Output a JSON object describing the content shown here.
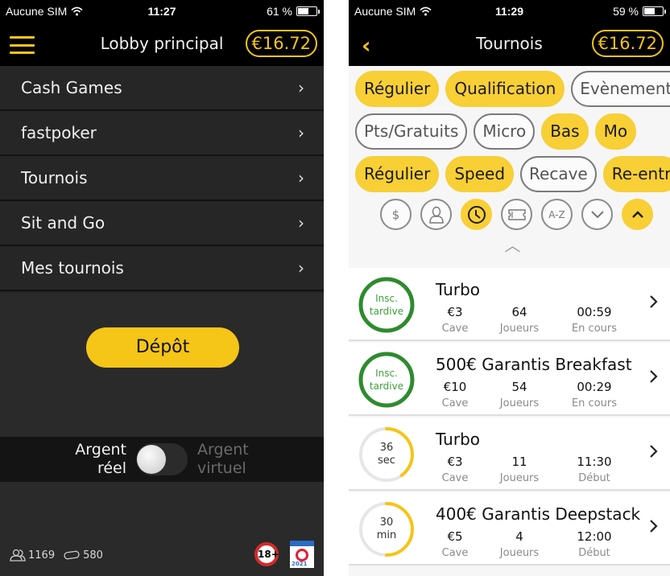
{
  "colors": {
    "accent": "#f5c518",
    "chip_active": "#f9cf36",
    "green_ring": "#2e8b2e",
    "yellow_ring": "#f6c415"
  },
  "left_screen": {
    "status": {
      "carrier": "Aucune SIM",
      "time": "11:27",
      "battery": "61 %",
      "battery_level": 0.61
    },
    "nav": {
      "menu_icon": "hamburger-icon",
      "title": "Lobby principal",
      "balance": "€16.72"
    },
    "menu": [
      {
        "label": "Cash Games",
        "icon": "chevron-right-icon",
        "chev": "›"
      },
      {
        "label": "fastpoker",
        "icon": "chevron-right-icon",
        "chev": "›"
      },
      {
        "label": "Tournois",
        "icon": "chevron-right-icon",
        "chev": "›"
      },
      {
        "label": "Sit and Go",
        "icon": "chevron-right-icon",
        "chev": "›"
      },
      {
        "label": "Mes tournois",
        "icon": "chevron-right-icon",
        "chev": "›"
      }
    ],
    "deposit_label": "Dépôt",
    "money_toggle": {
      "real_line1": "Argent",
      "real_line2": "réel",
      "virtual_line1": "Argent",
      "virtual_line2": "virtuel",
      "selected": "real"
    },
    "footer": {
      "players": "1169",
      "tables": "580",
      "age_badge": "18+",
      "arjel_year": "2021"
    }
  },
  "right_screen": {
    "status": {
      "carrier": "Aucune SIM",
      "time": "11:29",
      "battery": "59 %",
      "battery_level": 0.59
    },
    "nav": {
      "back_icon": "back-chevron-icon",
      "back_glyph": "‹",
      "title": "Tournois",
      "balance": "€16.72"
    },
    "filter_rows": [
      [
        {
          "label": "Régulier",
          "active": true
        },
        {
          "label": "Qualification",
          "active": true
        },
        {
          "label": "Evènements",
          "active": false
        }
      ],
      [
        {
          "label": "Pts/Gratuits",
          "active": false
        },
        {
          "label": "Micro",
          "active": false
        },
        {
          "label": "Bas",
          "active": true
        },
        {
          "label": "Mo",
          "active": true
        }
      ],
      [
        {
          "label": "Régulier",
          "active": true
        },
        {
          "label": "Speed",
          "active": true
        },
        {
          "label": "Recave",
          "active": false
        },
        {
          "label": "Re-entr",
          "active": true
        }
      ]
    ],
    "sort_icons": [
      {
        "name": "dollar-icon",
        "glyph": "$",
        "active": false
      },
      {
        "name": "player-icon",
        "glyph": "",
        "active": false
      },
      {
        "name": "clock-icon",
        "glyph": "",
        "active": true
      },
      {
        "name": "ticket-icon",
        "glyph": "",
        "active": false
      },
      {
        "name": "az-sort-icon",
        "glyph": "A-Z",
        "active": false
      },
      {
        "name": "sort-descending-icon",
        "glyph": "⌄",
        "active": false
      },
      {
        "name": "sort-ascending-icon",
        "glyph": "⌃",
        "active": true
      }
    ],
    "collapse_glyph": "︿",
    "tournaments": [
      {
        "name": "Turbo",
        "status_line1": "Insc.",
        "status_line2": "tardive",
        "status_type": "late",
        "progress": 1.0,
        "buyin": "€3",
        "buyin_label": "Cave",
        "players": "64",
        "players_label": "Joueurs",
        "time": "00:59",
        "time_label": "En cours"
      },
      {
        "name": "500€ Garantis Breakfast",
        "status_line1": "Insc.",
        "status_line2": "tardive",
        "status_type": "late",
        "progress": 1.0,
        "buyin": "€10",
        "buyin_label": "Cave",
        "players": "54",
        "players_label": "Joueurs",
        "time": "00:29",
        "time_label": "En cours"
      },
      {
        "name": "Turbo",
        "status_line1": "36",
        "status_line2": "sec",
        "status_type": "countdown",
        "progress": 0.4,
        "buyin": "€3",
        "buyin_label": "Cave",
        "players": "11",
        "players_label": "Joueurs",
        "time": "11:30",
        "time_label": "Début"
      },
      {
        "name": "400€ Garantis Deepstack",
        "status_line1": "30",
        "status_line2": "min",
        "status_type": "countdown",
        "progress": 0.5,
        "buyin": "€5",
        "buyin_label": "Cave",
        "players": "4",
        "players_label": "Joueurs",
        "time": "12:00",
        "time_label": "Début"
      }
    ]
  }
}
